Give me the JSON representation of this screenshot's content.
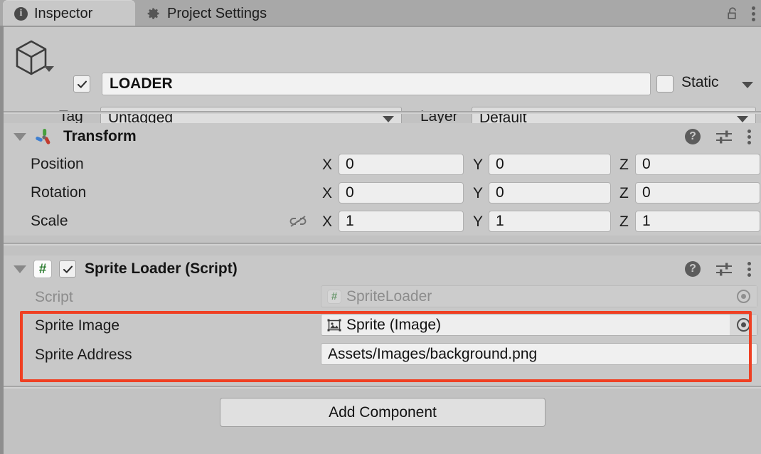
{
  "window": {
    "tabs": [
      {
        "label": "Inspector",
        "icon": "info-icon",
        "active": true
      },
      {
        "label": "Project Settings",
        "icon": "gear-icon",
        "active": false
      }
    ],
    "lock_icon": "lock-open-icon",
    "menu_icon": "kebab-menu-icon"
  },
  "gameobject": {
    "icon": "cube-icon",
    "enabled": true,
    "name": "LOADER",
    "static_label": "Static",
    "static_checked": false,
    "tag_label": "Tag",
    "tag_value": "Untagged",
    "layer_label": "Layer",
    "layer_value": "Default"
  },
  "transform": {
    "title": "Transform",
    "icon": "transform-axis-icon",
    "help_icon": "help-icon",
    "preset_icon": "preset-sliders-icon",
    "menu_icon": "kebab-menu-icon",
    "axes": [
      "X",
      "Y",
      "Z"
    ],
    "rows": [
      {
        "label": "Position",
        "values": [
          "0",
          "0",
          "0"
        ]
      },
      {
        "label": "Rotation",
        "values": [
          "0",
          "0",
          "0"
        ]
      },
      {
        "label": "Scale",
        "values": [
          "1",
          "1",
          "1"
        ],
        "link_icon": "unlink-icon"
      }
    ]
  },
  "sprite_loader": {
    "title": "Sprite Loader (Script)",
    "badge": "#",
    "enabled": true,
    "help_icon": "help-icon",
    "preset_icon": "preset-sliders-icon",
    "menu_icon": "kebab-menu-icon",
    "script_row": {
      "label": "Script",
      "value": "SpriteLoader",
      "badge": "#",
      "picker_icon": "object-picker-icon",
      "disabled": true
    },
    "sprite_image_row": {
      "label": "Sprite Image",
      "value": "Sprite (Image)",
      "icon": "image-asset-icon",
      "picker_icon": "object-picker-icon"
    },
    "sprite_address_row": {
      "label": "Sprite Address",
      "value": "Assets/Images/background.png"
    }
  },
  "add_component": {
    "label": "Add Component"
  },
  "annotation": {
    "color": "#ef4023",
    "shape": "rectangle-highlight"
  }
}
